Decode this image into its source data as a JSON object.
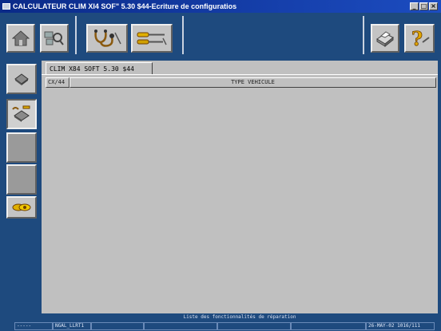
{
  "window": {
    "title": "CALCULATEUR CLIM XI4 SOF\" 5.30 $44-Ecriture de configuratios"
  },
  "toolbar": {
    "buttons": [
      {
        "name": "home",
        "icon": "home-icon"
      },
      {
        "name": "search",
        "icon": "search-icon"
      },
      {
        "name": "diagnostic",
        "icon": "stethoscope-icon"
      },
      {
        "name": "tools",
        "icon": "screwdriver-icon"
      },
      {
        "name": "print",
        "icon": "printer-icon"
      },
      {
        "name": "help",
        "icon": "help-icon"
      }
    ]
  },
  "left_panel": {
    "buttons": [
      {
        "name": "ecu",
        "icon": "ecu-chip-icon"
      },
      {
        "name": "ecu-config",
        "icon": "ecu-write-icon"
      },
      {
        "name": "empty1",
        "icon": ""
      },
      {
        "name": "empty2",
        "icon": ""
      },
      {
        "name": "link",
        "icon": "link-icon"
      }
    ]
  },
  "main": {
    "tab_label": "CLIM X84 SOFT 5.30 $44",
    "columns": [
      "CX/44",
      "TYPE VEHICULE"
    ]
  },
  "footer": {
    "message": "Liste des fonctionnalités de réparation"
  },
  "statusbar": {
    "cells": [
      "-----",
      "NGAL_LLRT1",
      "",
      "",
      "",
      "",
      "26-MAY-02  1016/111"
    ]
  }
}
